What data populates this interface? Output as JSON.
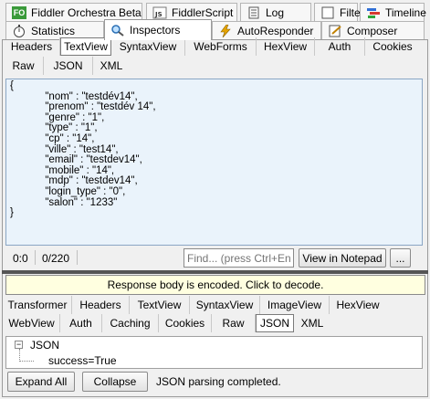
{
  "top_tabs_row1": [
    {
      "label": "Fiddler Orchestra Beta",
      "icon": "fiddler-orchestra-icon"
    },
    {
      "label": "FiddlerScript",
      "icon": "script-js-icon"
    },
    {
      "label": "Log",
      "icon": "log-icon"
    },
    {
      "label": "Filters",
      "icon": "filters-checkbox-icon"
    },
    {
      "label": "Timeline",
      "icon": "timeline-icon"
    }
  ],
  "top_tabs_row2": [
    {
      "label": "Statistics",
      "icon": "stopwatch-icon"
    },
    {
      "label": "Inspectors",
      "icon": "inspectors-icon"
    },
    {
      "label": "AutoResponder",
      "icon": "lightning-icon"
    },
    {
      "label": "Composer",
      "icon": "composer-icon"
    }
  ],
  "request_tabs_row1": [
    "Headers",
    "TextView",
    "SyntaxView",
    "WebForms",
    "HexView",
    "Auth",
    "Cookies"
  ],
  "request_tabs_row2": [
    "Raw",
    "JSON",
    "XML"
  ],
  "request_body": {
    "lines": [
      "{",
      "\t\t\"nom\" : \"testdév14\",",
      "\t\t\"prenom\" : \"testdév 14\",",
      "\t\t\"genre\" : \"1\",",
      "\t\t\"type\" : \"1\",",
      "\t\t\"cp\" : \"14\",",
      "\t\t\"ville\" : \"test14\",",
      "\t\t\"email\" : \"testdev14\",",
      "\t\t\"mobile\" : \"14\",",
      "\t\t\"mdp\" : \"testdev14\",",
      "\t\t\"login_type\" : \"0\",",
      "\t\t\"salon\" : \"1233\"",
      "}"
    ]
  },
  "status_bar": {
    "position": "0:0",
    "count": "0/220",
    "find_placeholder": "Find... (press Ctrl+Enter",
    "view_notepad": "View in Notepad",
    "more": "..."
  },
  "encoded_banner": "Response body is encoded. Click to decode.",
  "response_tabs_row1": [
    "Transformer",
    "Headers",
    "TextView",
    "SyntaxView",
    "ImageView",
    "HexView"
  ],
  "response_tabs_row2": [
    "WebView",
    "Auth",
    "Caching",
    "Cookies",
    "Raw",
    "JSON",
    "XML"
  ],
  "response_tree": {
    "root": "JSON",
    "child": "success=True",
    "expander": "−"
  },
  "bottom": {
    "expand_all": "Expand All",
    "collapse": "Collapse",
    "status": "JSON parsing completed."
  },
  "colors": {
    "panel_bg": "#f0f0f0",
    "textarea_bg": "#eaf3fb",
    "banner_bg": "#ffffe0",
    "fo_icon": "#3a9a3a"
  }
}
